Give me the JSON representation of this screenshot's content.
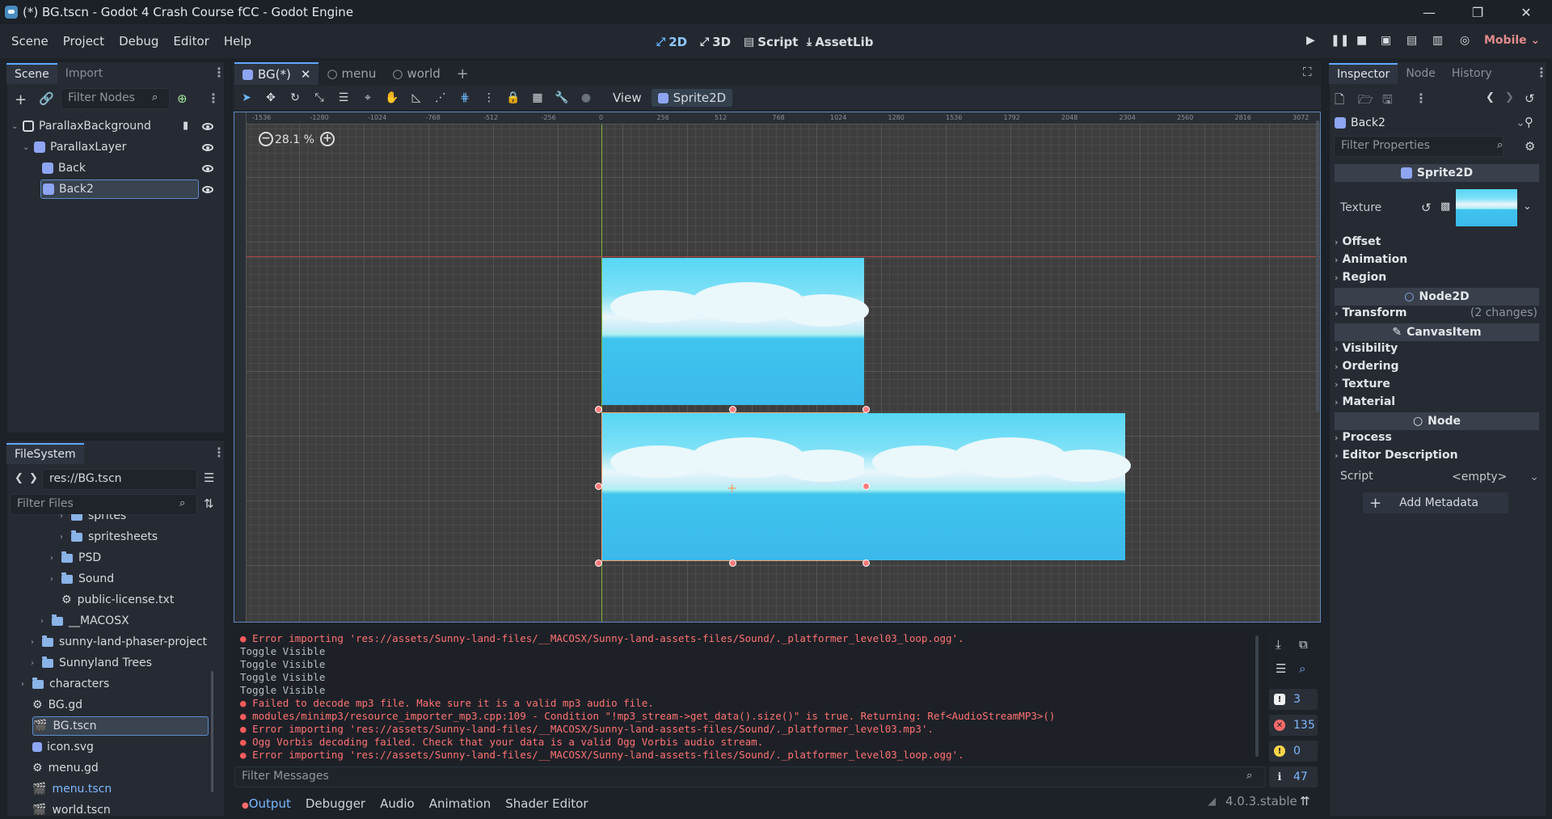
{
  "window": {
    "title": "(*) BG.tscn - Godot 4 Crash Course fCC - Godot Engine",
    "minimize": "—",
    "maximize": "❐",
    "close": "✕"
  },
  "menu": {
    "items": [
      "Scene",
      "Project",
      "Debug",
      "Editor",
      "Help"
    ]
  },
  "workspaces": {
    "w2d": "2D",
    "w3d": "3D",
    "script": "Script",
    "assetlib": "AssetLib",
    "renderer": "Mobile"
  },
  "scene_dock": {
    "tabs": [
      "Scene",
      "Import"
    ],
    "filter_placeholder": "Filter Nodes",
    "nodes": [
      {
        "label": "ParallaxBackground"
      },
      {
        "label": "ParallaxLayer"
      },
      {
        "label": "Back"
      },
      {
        "label": "Back2"
      }
    ]
  },
  "filesystem": {
    "tab": "FileSystem",
    "path": "res://BG.tscn",
    "filter_placeholder": "Filter Files",
    "items": [
      {
        "label": "sprites"
      },
      {
        "label": "spritesheets"
      },
      {
        "label": "PSD"
      },
      {
        "label": "Sound"
      },
      {
        "label": "public-license.txt"
      },
      {
        "label": "__MACOSX"
      },
      {
        "label": "sunny-land-phaser-project"
      },
      {
        "label": "Sunnyland Trees"
      },
      {
        "label": "characters"
      },
      {
        "label": "BG.gd"
      },
      {
        "label": "BG.tscn"
      },
      {
        "label": "icon.svg"
      },
      {
        "label": "menu.gd"
      },
      {
        "label": "menu.tscn"
      },
      {
        "label": "world.tscn"
      }
    ]
  },
  "doc_tabs": [
    "BG(*)",
    "menu",
    "world"
  ],
  "toolbar": {
    "view": "View",
    "sprite2d": "Sprite2D"
  },
  "viewport": {
    "zoom": "28.1 %",
    "ruler_h": [
      "-1536",
      "-1280",
      "-1024",
      "-768",
      "-512",
      "-256",
      "0",
      "256",
      "512",
      "768",
      "1024",
      "1280",
      "1536",
      "1792",
      "2048",
      "2304",
      "2560",
      "2816",
      "3072"
    ]
  },
  "output": {
    "lines": [
      {
        "type": "err",
        "text": "Error importing 'res://assets/Sunny-land-files/__MACOSX/Sunny-land-assets-files/Sound/._platformer_level03_loop.ogg'."
      },
      {
        "type": "plain",
        "text": "Toggle Visible"
      },
      {
        "type": "plain",
        "text": "Toggle Visible"
      },
      {
        "type": "plain",
        "text": "Toggle Visible"
      },
      {
        "type": "plain",
        "text": "Toggle Visible"
      },
      {
        "type": "err",
        "text": "Failed to decode mp3 file. Make sure it is a valid mp3 audio file."
      },
      {
        "type": "err",
        "text": "modules/minimp3/resource_importer_mp3.cpp:109 - Condition \"!mp3_stream->get_data().size()\" is true. Returning: Ref<AudioStreamMP3>()"
      },
      {
        "type": "err",
        "text": "Error importing 'res://assets/Sunny-land-files/__MACOSX/Sunny-land-assets-files/Sound/._platformer_level03.mp3'."
      },
      {
        "type": "err",
        "text": "Ogg Vorbis decoding failed. Check that your data is a valid Ogg Vorbis audio stream."
      },
      {
        "type": "err",
        "text": "Error importing 'res://assets/Sunny-land-files/__MACOSX/Sunny-land-assets-files/Sound/._platformer_level03_loop.ogg'."
      }
    ],
    "filter_placeholder": "Filter Messages",
    "counts": {
      "errors_group": "3",
      "errors": "135",
      "warnings": "0",
      "messages": "47"
    }
  },
  "bottom_tabs": [
    "Output",
    "Debugger",
    "Audio",
    "Animation",
    "Shader Editor"
  ],
  "version": "4.0.3.stable",
  "inspector": {
    "tabs": [
      "Inspector",
      "Node",
      "History"
    ],
    "object": "Back2",
    "filter_placeholder": "Filter Properties",
    "class_sprite": "Sprite2D",
    "texture_label": "Texture",
    "sections1": [
      "Offset",
      "Animation",
      "Region"
    ],
    "class_node2d": "Node2D",
    "transform": "Transform",
    "transform_changes": "(2 changes)",
    "class_canvas": "CanvasItem",
    "sections2": [
      "Visibility",
      "Ordering",
      "Texture",
      "Material"
    ],
    "class_node": "Node",
    "sections3": [
      "Process",
      "Editor Description"
    ],
    "script_label": "Script",
    "script_value": "<empty>",
    "add_metadata": "Add Metadata"
  }
}
